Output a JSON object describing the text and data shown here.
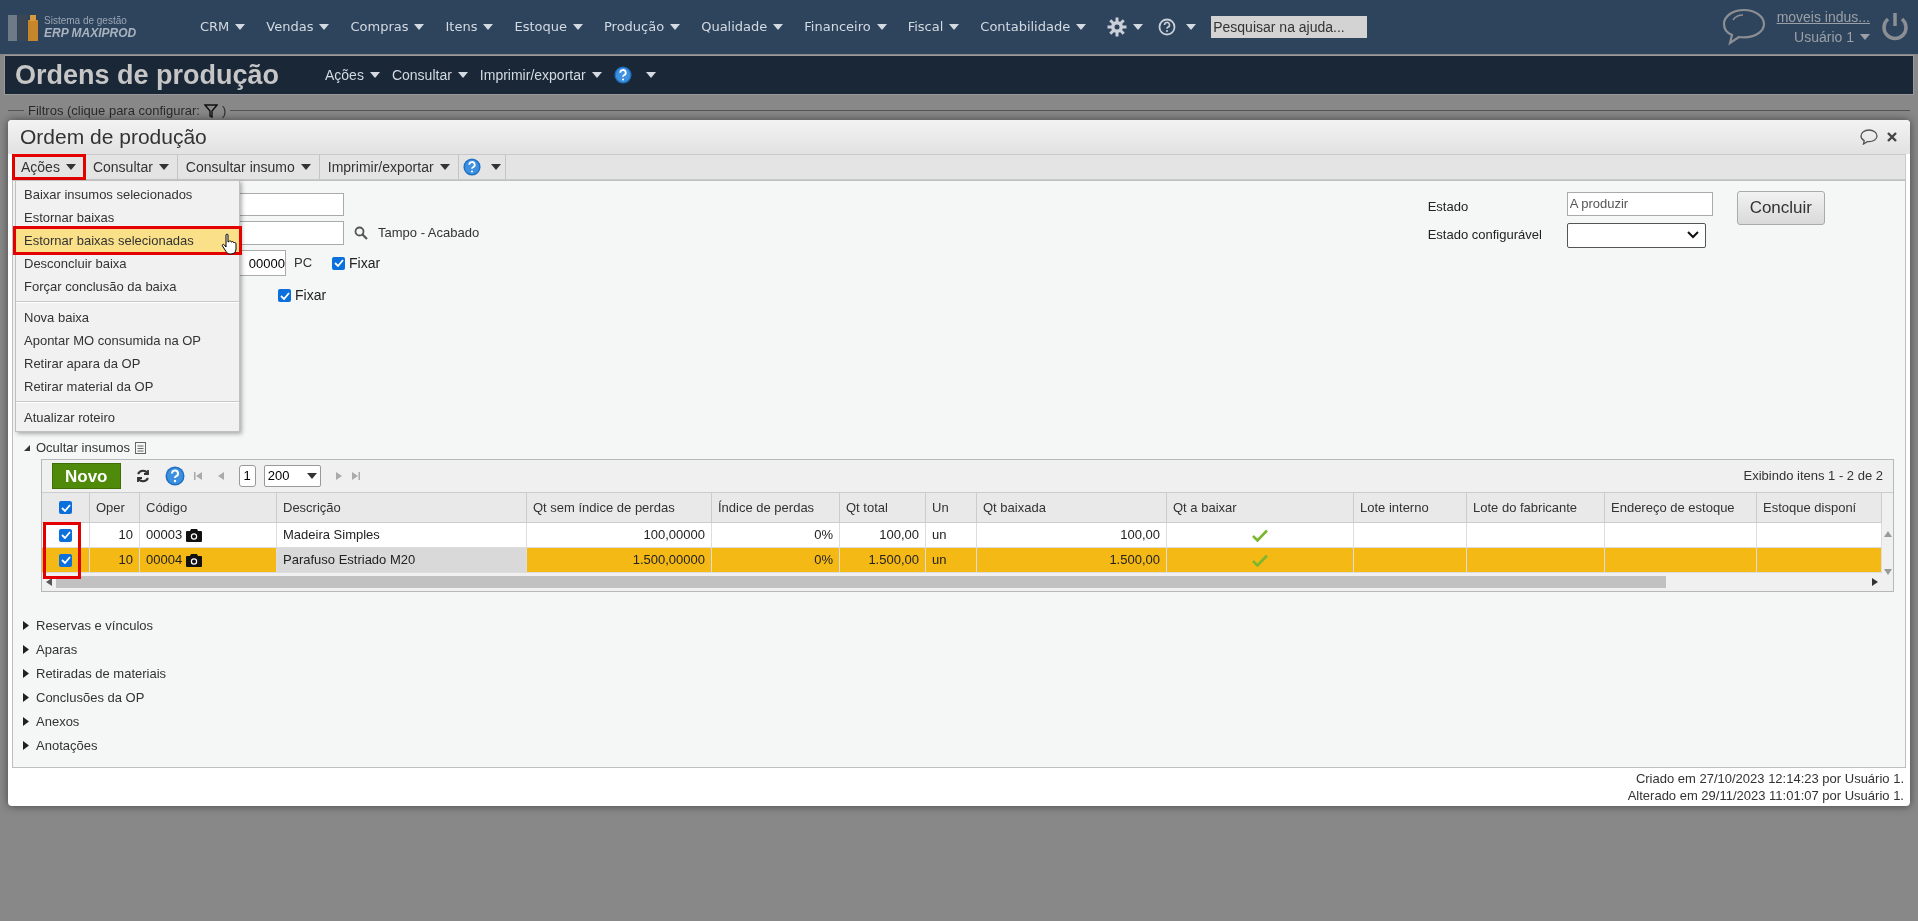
{
  "app": {
    "logo_line1": "Sistema de gestão",
    "logo_line2": "ERP MAXIPROD"
  },
  "top_menu": [
    "CRM",
    "Vendas",
    "Compras",
    "Itens",
    "Estoque",
    "Produção",
    "Qualidade",
    "Financeiro",
    "Fiscal",
    "Contabilidade"
  ],
  "help_search": {
    "placeholder": "Pesquisar na ajuda..."
  },
  "user": {
    "company": "moveis indus...",
    "name": "Usuário 1"
  },
  "page": {
    "title": "Ordens de produção",
    "menu": [
      "Ações",
      "Consultar",
      "Imprimir/exportar"
    ]
  },
  "filters": {
    "label_start": "Filtros (clique para configurar:",
    "label_end": ")"
  },
  "dialog": {
    "title": "Ordem de produção",
    "toolbar": [
      {
        "label": "Ações",
        "annotated": true
      },
      {
        "label": "Consultar",
        "annotated": false
      },
      {
        "label": "Consultar insumo",
        "annotated": false
      },
      {
        "label": "Imprimir/exportar",
        "annotated": false
      }
    ],
    "actions_menu": [
      [
        {
          "label": "Baixar insumos selecionados",
          "selected": false,
          "annotated": false
        },
        {
          "label": "Estornar baixas",
          "selected": false,
          "annotated": false
        },
        {
          "label": "Estornar baixas selecionadas",
          "selected": true,
          "annotated": true
        },
        {
          "label": "Desconcluir baixa",
          "selected": false,
          "annotated": false
        },
        {
          "label": "Forçar conclusão da baixa",
          "selected": false,
          "annotated": false
        }
      ],
      [
        {
          "label": "Nova baixa",
          "selected": false,
          "annotated": false
        },
        {
          "label": "Apontar MO consumida na OP",
          "selected": false,
          "annotated": false
        },
        {
          "label": "Retirar apara da OP",
          "selected": false,
          "annotated": false
        },
        {
          "label": "Retirar material da OP",
          "selected": false,
          "annotated": false
        }
      ],
      [
        {
          "label": "Atualizar roteiro",
          "selected": false,
          "annotated": false
        }
      ]
    ],
    "form": {
      "product_description": "Tampo - Acabado",
      "quantity_value": "00000",
      "unit": "PC",
      "fix_quantity": {
        "label": "Fixar",
        "checked": true
      },
      "fix_date": {
        "label": "Fixar",
        "checked": true
      },
      "state_label": "Estado",
      "state_value": "A produzir",
      "configurable_state_label": "Estado configurável",
      "conclude_button": "Concluir"
    },
    "inputs_section": {
      "label": "Ocultar insumos",
      "expanded": true
    },
    "grid": {
      "new_button": "Novo",
      "page": "1",
      "page_size": "200",
      "info": "Exibindo itens 1 - 2 de 2",
      "checkbox_column_annotated": true,
      "all_checked": true,
      "columns": [
        "Oper",
        "Código",
        "Descrição",
        "Qt sem índice de perdas",
        "Índice de perdas",
        "Qt total",
        "Un",
        "Qt baixada",
        "Qt a baixar",
        "Lote interno",
        "Lote do fabricante",
        "Endereço de estoque",
        "Estoque disponí"
      ],
      "rows": [
        {
          "checked": true,
          "selected": false,
          "oper": "10",
          "code": "00003",
          "has_photo": true,
          "description": "Madeira Simples",
          "qty_no_loss": "100,00000",
          "loss_index": "0%",
          "qty_total": "100,00",
          "unit": "un",
          "qty_withdrawn": "100,00",
          "fully_withdrawn": true
        },
        {
          "checked": true,
          "selected": true,
          "oper": "10",
          "code": "00004",
          "has_photo": true,
          "description": "Parafuso Estriado M20",
          "qty_no_loss": "1.500,00000",
          "loss_index": "0%",
          "qty_total": "1.500,00",
          "unit": "un",
          "qty_withdrawn": "1.500,00",
          "fully_withdrawn": true
        }
      ]
    },
    "sections": [
      {
        "label": "Reservas e vínculos",
        "expanded": false
      },
      {
        "label": "Aparas",
        "expanded": false
      },
      {
        "label": "Retiradas de materiais",
        "expanded": false
      },
      {
        "label": "Conclusões da OP",
        "expanded": false
      },
      {
        "label": "Anexos",
        "expanded": false
      },
      {
        "label": "Anotações",
        "expanded": false
      }
    ],
    "footer": [
      "Criado em 27/10/2023 12:14:23 por Usuário 1.",
      "Alterado em 29/11/2023 11:01:07 por Usuário 1."
    ]
  }
}
